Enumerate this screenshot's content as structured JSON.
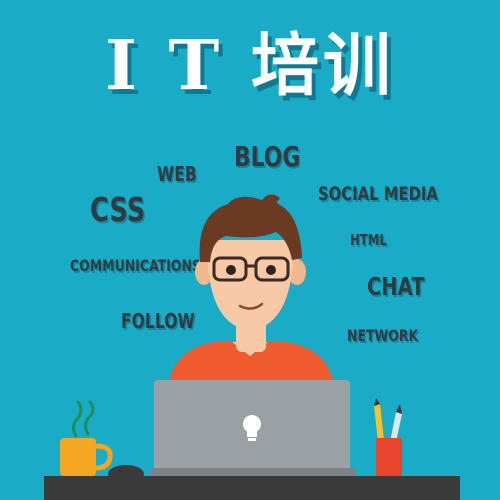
{
  "title": "I T 培训",
  "words": {
    "blog": "BLOG",
    "web": "WEB",
    "social_media": "SOCIAL MEDIA",
    "css": "CSS",
    "html": "HTML",
    "communications": "COMMUNICATIONS",
    "chat": "CHAT",
    "follow": "FOLLOW",
    "network": "NETWORK"
  },
  "colors": {
    "background": "#1aabc6",
    "shirt": "#ef5a2f",
    "laptop": "#9aa0a4",
    "mug": "#f5a623",
    "pen_cup": "#e8452c",
    "desk": "#3a3a3a"
  }
}
